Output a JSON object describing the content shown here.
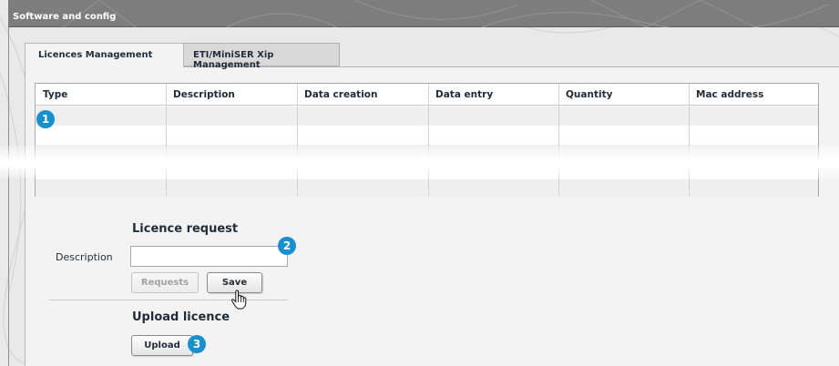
{
  "window": {
    "title": "Software and config"
  },
  "tabs": [
    {
      "label": "Licences Management",
      "active": true
    },
    {
      "label": "ETI/MiniSER Xip Management",
      "active": false
    }
  ],
  "table": {
    "columns": [
      "Type",
      "Description",
      "Data creation",
      "Data entry",
      "Quantity",
      "Mac address"
    ],
    "rows": []
  },
  "markers": {
    "one": "1",
    "two": "2",
    "three": "3"
  },
  "licence_request": {
    "title": "Licence request",
    "description_label": "Description",
    "description_value": "",
    "requests_button": "Requests",
    "save_button": "Save"
  },
  "upload_licence": {
    "title": "Upload licence",
    "upload_button": "Upload"
  },
  "colors": {
    "accent": "#1a8fd0",
    "title_bar": "#7d7d7d",
    "panel": "#f3f3f3"
  }
}
